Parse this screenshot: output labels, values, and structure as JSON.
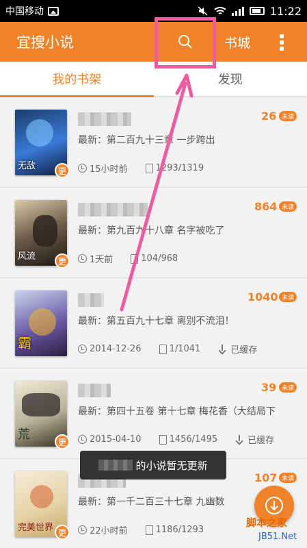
{
  "status_bar": {
    "carrier": "中国移动",
    "time": "11:22"
  },
  "app_bar": {
    "title": "宜搜小说",
    "store": "书城"
  },
  "tabs": [
    {
      "label": "我的书架"
    },
    {
      "label": "发现"
    }
  ],
  "books": [
    {
      "latest": "最新：第二百九十三章 一步跨出",
      "updated": "15小时前",
      "progress": "1293/1319",
      "count": "26",
      "badge": "未读",
      "cover_title": "无敌",
      "update_badge": "更",
      "cached": ""
    },
    {
      "latest": "最新：第九百九十八章 名字被吃了",
      "updated": "1天前",
      "progress": "104/968",
      "count": "864",
      "badge": "未读",
      "cover_title": "风流",
      "update_badge": "更",
      "cached": ""
    },
    {
      "latest": "最新：第五百九十七章 离别不流泪！",
      "updated": "2014-12-26",
      "progress": "1/1041",
      "count": "1040",
      "badge": "未读",
      "cover_title": "霸",
      "update_badge": "",
      "cached": "已缓存"
    },
    {
      "latest": "最新：第四十五卷 第十七章 梅花香（大结局下",
      "updated": "2015-04-10",
      "progress": "1456/1495",
      "count": "39",
      "badge": "未读",
      "cover_title": "荒",
      "update_badge": "更",
      "cached": "已缓存"
    },
    {
      "latest": "最新：第一千二百三十七章 九幽数",
      "updated": "22小时前",
      "progress": "1186/1293",
      "count": "107",
      "badge": "未读",
      "cover_title": "完美世界",
      "update_badge": "更",
      "cached": ""
    }
  ],
  "toast": {
    "text": "的小说暂无更新"
  },
  "watermark": {
    "main": "脚本之家",
    "sub": "JB51.Net"
  },
  "colors": {
    "accent": "#f0832a",
    "highlight": "#f05aa0"
  }
}
